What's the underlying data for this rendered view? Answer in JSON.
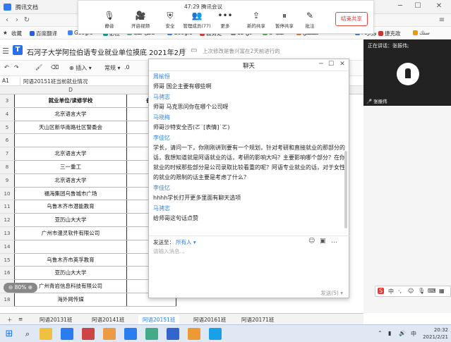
{
  "window": {
    "title": "腾讯文档"
  },
  "bookmarks": [
    "收藏",
    "百度翻译",
    "Google",
    "必应",
    "كامل كتب",
    "Google",
    "教务处",
    "12 دي",
    "كتب عا",
    "فصصي",
    "وزارة ا",
    "捷克政",
    "ستك"
  ],
  "doc": {
    "title": "石河子大学阿拉伯语专业就业单位摸底 2021年2月",
    "status": "上次修改是鲁兴富在2天前进行的"
  },
  "toolbar": {
    "insert": "插入",
    "style": "常规",
    "decimal": ".0",
    "fontsize": "10"
  },
  "formula": {
    "cell_ref": "A1",
    "content": "阿语20151班当前就业情况"
  },
  "sheet": {
    "col_d": "D",
    "rows": [
      {
        "num": "3",
        "d": "就业单位/读修学校",
        "e": "备注"
      },
      {
        "num": "4",
        "d": "北京语言大学",
        "e": ""
      },
      {
        "num": "5",
        "d": "天山区新华南路社区警委会",
        "e": ""
      },
      {
        "num": "6",
        "d": "",
        "e": ""
      },
      {
        "num": "7",
        "d": "北京语言大学",
        "e": ""
      },
      {
        "num": "8",
        "d": "三一重工",
        "e": ""
      },
      {
        "num": "9",
        "d": "北京语言大学",
        "e": ""
      },
      {
        "num": "10",
        "d": "福海集团乌鲁城市广场",
        "e": ""
      },
      {
        "num": "11",
        "d": "乌鲁木齐市潜能教育",
        "e": ""
      },
      {
        "num": "12",
        "d": "亚历山大大学",
        "e": ""
      },
      {
        "num": "13",
        "d": "广州市漫灵软件有限公司",
        "e": ""
      },
      {
        "num": "14",
        "d": "",
        "e": ""
      },
      {
        "num": "15",
        "d": "乌鲁木齐市英孚教育",
        "e": ""
      },
      {
        "num": "16",
        "d": "亚历山大大学",
        "e": ""
      },
      {
        "num": "17",
        "d": "广州青岩信息科技有限公司",
        "e": ""
      },
      {
        "num": "18",
        "d": "海外网传媒",
        "e": ""
      }
    ]
  },
  "sheet_tabs": [
    "阿语20131班",
    "阿语20141班",
    "阿语20151班",
    "阿语20161班",
    "阿语20171班"
  ],
  "meeting": {
    "time": "47:29  腾讯会议",
    "buttons": [
      "静音",
      "开启视频",
      "安全",
      "管理成员(77)",
      "更多",
      "新的共享",
      "暂停共享",
      "批注"
    ],
    "end_label": "结束共享"
  },
  "chat": {
    "title": "聊天",
    "messages": [
      {
        "sender": "周榆恒",
        "text": "师哥 国企主要有哪些啊"
      },
      {
        "sender": "马骋志",
        "text": "师哥 马克思问你在哪个公司呀"
      },
      {
        "sender": "马晓梅",
        "text": "师哥沙特安全否(ㄛ˙[表情]˙ㄛ)"
      },
      {
        "sender": "李佳忆",
        "text": "学长，请问一下，你刚刚讲到要有一个规划，针对考研和直接就业的那部分的话，我想知道就是阿语就业的话，考研的影响大吗？主要影响哪个部分？在你就业的时候那些部分是公司录取比较看重的呢？阿语专业就业的话，对于女性的就业的限制的话主要是考虑了什么？"
      },
      {
        "sender": "李佳忆",
        "text": "hhhh学长打开更多里面有聊天选项"
      },
      {
        "sender": "马骋志",
        "text": "给师哥这句话点赞"
      }
    ],
    "send_label": "发送至：",
    "send_target": "所有人 ▾",
    "input_placeholder": "请输入消息...",
    "send_button": "发送(S) ▾"
  },
  "video": {
    "speaking": "正在讲话：张振伟;",
    "name": "张振伟"
  },
  "zoom": "80%",
  "clock": {
    "time": "20:32",
    "date": "2021/2/21"
  },
  "colors": {
    "accent": "#2a7df0",
    "chat_sender": "#3a86d8",
    "end": "#e33333"
  }
}
